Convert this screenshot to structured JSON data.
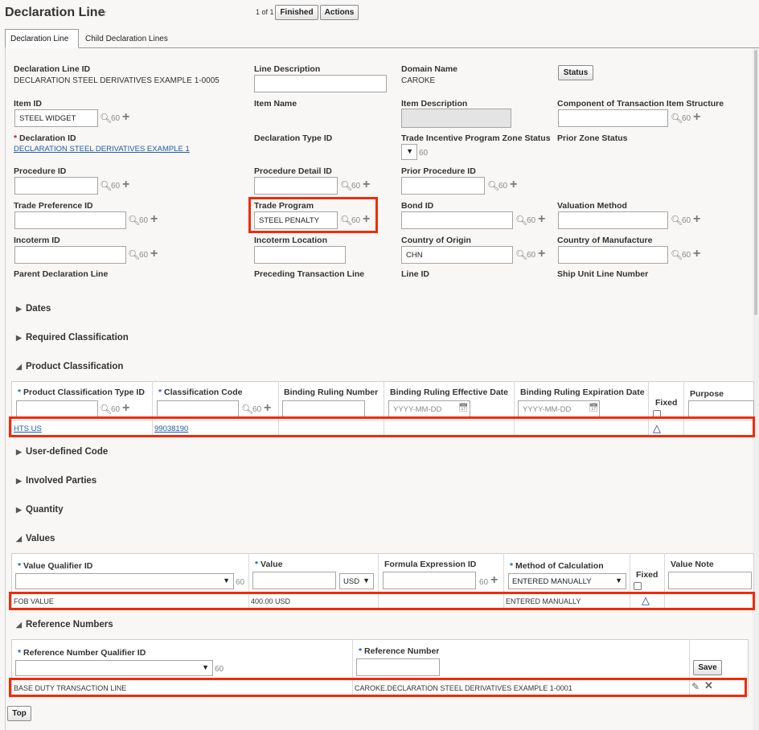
{
  "header": {
    "title": "Declaration Line",
    "pager": "1 of 1",
    "finished_label": "Finished",
    "actions_label": "Actions"
  },
  "tabs": [
    "Declaration Line",
    "Child Declaration Lines"
  ],
  "form": {
    "declaration_line_id_label": "Declaration Line ID",
    "declaration_line_id_value": "DECLARATION STEEL DERIVATIVES EXAMPLE 1-0005",
    "line_description_label": "Line Description",
    "domain_name_label": "Domain Name",
    "domain_name_value": "CAROKE",
    "status_label": "Status",
    "item_id_label": "Item ID",
    "item_id_value": "STEEL WIDGET",
    "item_name_label": "Item Name",
    "item_description_label": "Item Description",
    "component_label": "Component of Transaction Item Structure",
    "declaration_id_label": "Declaration ID",
    "declaration_id_value": "DECLARATION STEEL DERIVATIVES EXAMPLE 1",
    "declaration_type_id_label": "Declaration Type ID",
    "tip_zone_status_label": "Trade Incentive Program Zone Status",
    "prior_zone_status_label": "Prior Zone Status",
    "procedure_id_label": "Procedure ID",
    "procedure_detail_id_label": "Procedure Detail ID",
    "prior_procedure_id_label": "Prior Procedure ID",
    "trade_preference_id_label": "Trade Preference ID",
    "trade_program_label": "Trade Program",
    "trade_program_value": "STEEL PENALTY",
    "bond_id_label": "Bond ID",
    "valuation_method_label": "Valuation Method",
    "incoterm_id_label": "Incoterm ID",
    "incoterm_location_label": "Incoterm Location",
    "country_of_origin_label": "Country of Origin",
    "country_of_origin_value": "CHN",
    "country_of_manufacture_label": "Country of Manufacture",
    "parent_declaration_line_label": "Parent Declaration Line",
    "preceding_transaction_line_label": "Preceding Transaction Line",
    "line_id_label": "Line ID",
    "ship_unit_line_number_label": "Ship Unit Line Number"
  },
  "sections": {
    "dates": "Dates",
    "required_classification": "Required Classification",
    "product_classification": "Product Classification",
    "user_defined_code": "User-defined Code",
    "involved_parties": "Involved Parties",
    "quantity": "Quantity",
    "values": "Values",
    "reference_numbers": "Reference Numbers"
  },
  "product_classification": {
    "headers": [
      "Product Classification Type ID",
      "Classification Code",
      "Binding Ruling Number",
      "Binding Ruling Effective Date",
      "Binding Ruling Expiration Date",
      "Fixed",
      "Purpose"
    ],
    "date_placeholder": "YYYY-MM-DD",
    "row": {
      "type_id": "HTS US",
      "code": "99038190"
    }
  },
  "values": {
    "headers": [
      "Value Qualifier ID",
      "Value",
      "Formula Expression ID",
      "Method of Calculation",
      "Fixed",
      "Value Note"
    ],
    "currency": "USD",
    "method_default": "ENTERED MANUALLY",
    "row": {
      "qualifier": "FOB VALUE",
      "value": "400.00 USD",
      "method": "ENTERED MANUALLY"
    }
  },
  "reference_numbers": {
    "headers": [
      "Reference Number Qualifier ID",
      "Reference Number"
    ],
    "save_label": "Save",
    "row": {
      "qualifier": "BASE DUTY TRANSACTION LINE",
      "number": "CAROKE.DECLARATION STEEL DERIVATIVES EXAMPLE 1-0001"
    }
  },
  "footer": {
    "top_label": "Top"
  },
  "colors": {
    "highlight": "#f12b0a",
    "link": "#1f5aa8",
    "required_star_red": "#c4122f",
    "required_star_blue": "#2a5db8"
  },
  "icons": [
    "star-icon",
    "search-icon",
    "glasses-icon",
    "plus-icon",
    "calendar-icon",
    "warning-triangle-icon",
    "pencil-icon",
    "delete-icon",
    "triangle-right-icon",
    "triangle-down-icon"
  ]
}
